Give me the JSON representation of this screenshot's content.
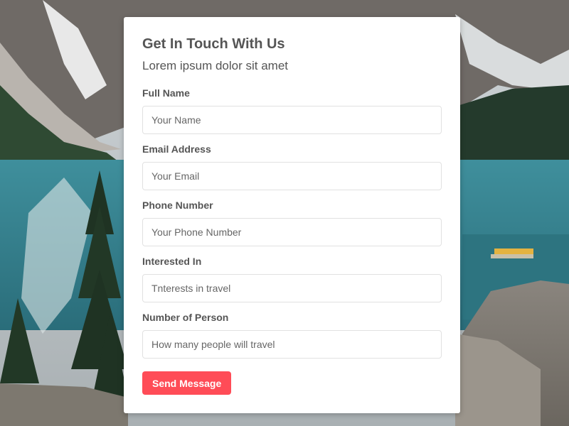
{
  "form": {
    "title": "Get In Touch With Us",
    "subtitle": "Lorem ipsum dolor sit amet",
    "fields": [
      {
        "label": "Full Name",
        "placeholder": "Your Name"
      },
      {
        "label": "Email Address",
        "placeholder": "Your Email"
      },
      {
        "label": "Phone Number",
        "placeholder": "Your Phone Number"
      },
      {
        "label": "Interested In",
        "placeholder": "Tnterests in travel"
      },
      {
        "label": "Number of Person",
        "placeholder": "How many people will travel"
      }
    ],
    "submit_label": "Send Message"
  },
  "colors": {
    "accent": "#ff4c57",
    "text": "#555555",
    "border": "#e1e1e1"
  }
}
